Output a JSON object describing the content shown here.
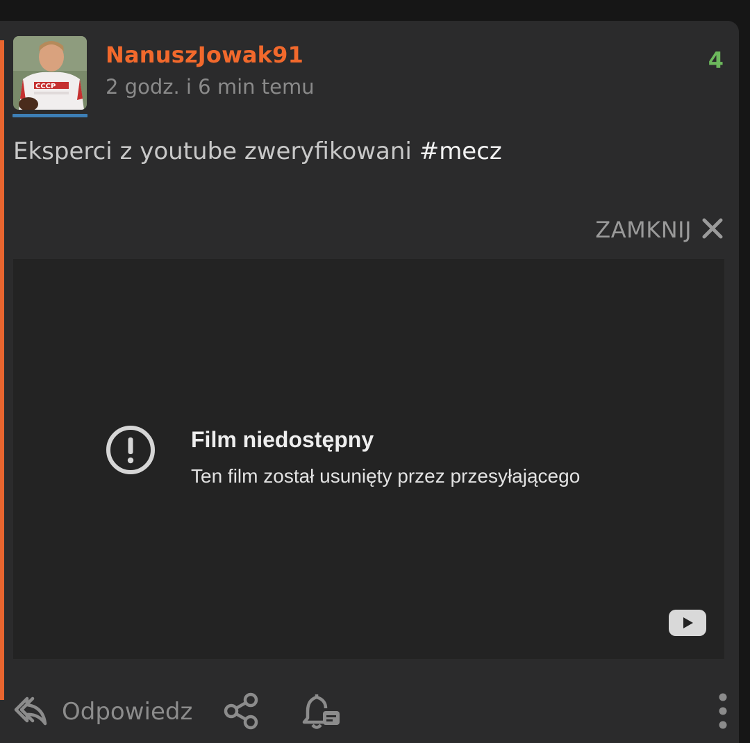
{
  "post": {
    "author": "NanuszJowak91",
    "time_ago": "2 godz. i 6 min temu",
    "votes": "4",
    "text": "Eksperci z youtube zweryfikowani ",
    "hashtag": "#mecz"
  },
  "embed": {
    "close_label": "ZAMKNIJ",
    "video_title": "Film niedostępny",
    "video_message": "Ten film został usunięty przez przesyłającego"
  },
  "actions": {
    "reply_label": "Odpowiedz"
  },
  "colors": {
    "accent": "#e8652f",
    "username": "#f2692c",
    "votes": "#6cb85c",
    "avatar_underline": "#3d7fb6"
  }
}
